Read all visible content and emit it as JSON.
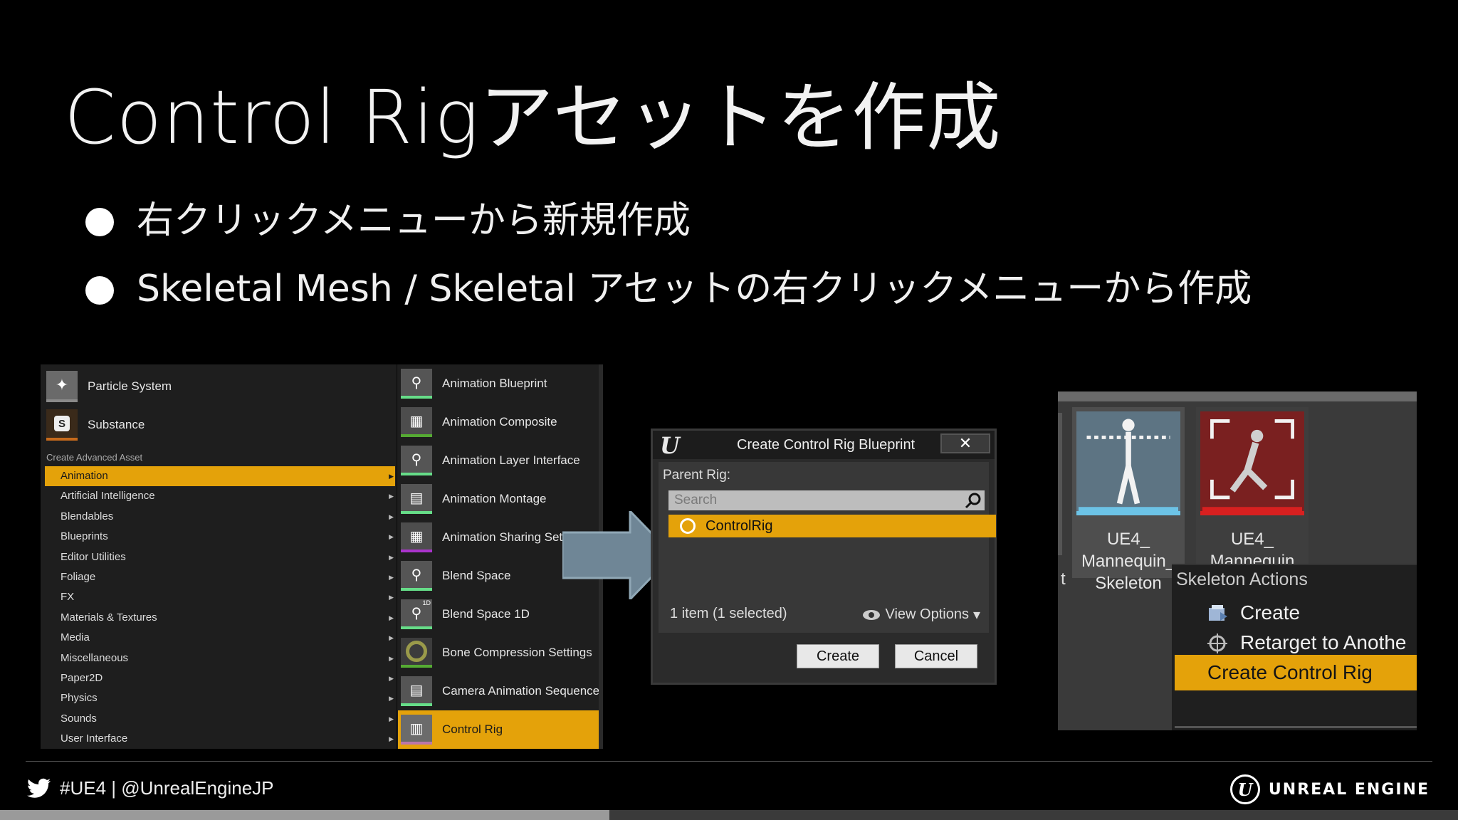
{
  "slide": {
    "title": "Control Rigアセットを作成",
    "bullets": [
      "右クリックメニューから新規作成",
      "Skeletal Mesh / Skeletal アセットの右クリックメニューから作成"
    ]
  },
  "context_menu": {
    "assets": [
      {
        "label": "Particle System",
        "icon": "particle-icon"
      },
      {
        "label": "Substance",
        "icon": "substance-icon",
        "badge": "S"
      }
    ],
    "section_header": "Create Advanced Asset",
    "categories": [
      "Animation",
      "Artificial Intelligence",
      "Blendables",
      "Blueprints",
      "Editor Utilities",
      "Foliage",
      "FX",
      "Materials & Textures",
      "Media",
      "Miscellaneous",
      "Paper2D",
      "Physics",
      "Sounds",
      "User Interface"
    ],
    "selected_category": "Animation",
    "submenu": [
      "Animation Blueprint",
      "Animation Composite",
      "Animation Layer Interface",
      "Animation Montage",
      "Animation Sharing Setup",
      "Blend Space",
      "Blend Space 1D",
      "Bone Compression Settings",
      "Camera Animation Sequence",
      "Control Rig"
    ],
    "blend_space_1d_badge": "1D",
    "selected_submenu": "Control Rig"
  },
  "dialog": {
    "title": "Create Control Rig Blueprint",
    "close_glyph": "✕",
    "parent_label": "Parent Rig:",
    "search_placeholder": "Search",
    "selected_item": "ControlRig",
    "items_count": "1 item (1 selected)",
    "view_options": "View Options",
    "dropdown_glyph": "▾",
    "create_label": "Create",
    "cancel_label": "Cancel",
    "logo_glyph": "U"
  },
  "content_browser": {
    "tiles": [
      {
        "label": "UE4_ Mannequin_ Skeleton"
      },
      {
        "label": "UE4_ Mannequin"
      }
    ],
    "clipped_char": "t",
    "actions_title": "Skeleton Actions",
    "actions": [
      {
        "label": "Create",
        "icon": "create-icon"
      },
      {
        "label": "Retarget to Anothe",
        "icon": "retarget-icon"
      },
      {
        "label": "Create Control Rig",
        "icon": ""
      }
    ]
  },
  "footer": {
    "handle": "#UE4 | @UnrealEngineJP",
    "brand": "UNREAL ENGINE",
    "logo_glyph": "U",
    "progress": 0.418
  }
}
